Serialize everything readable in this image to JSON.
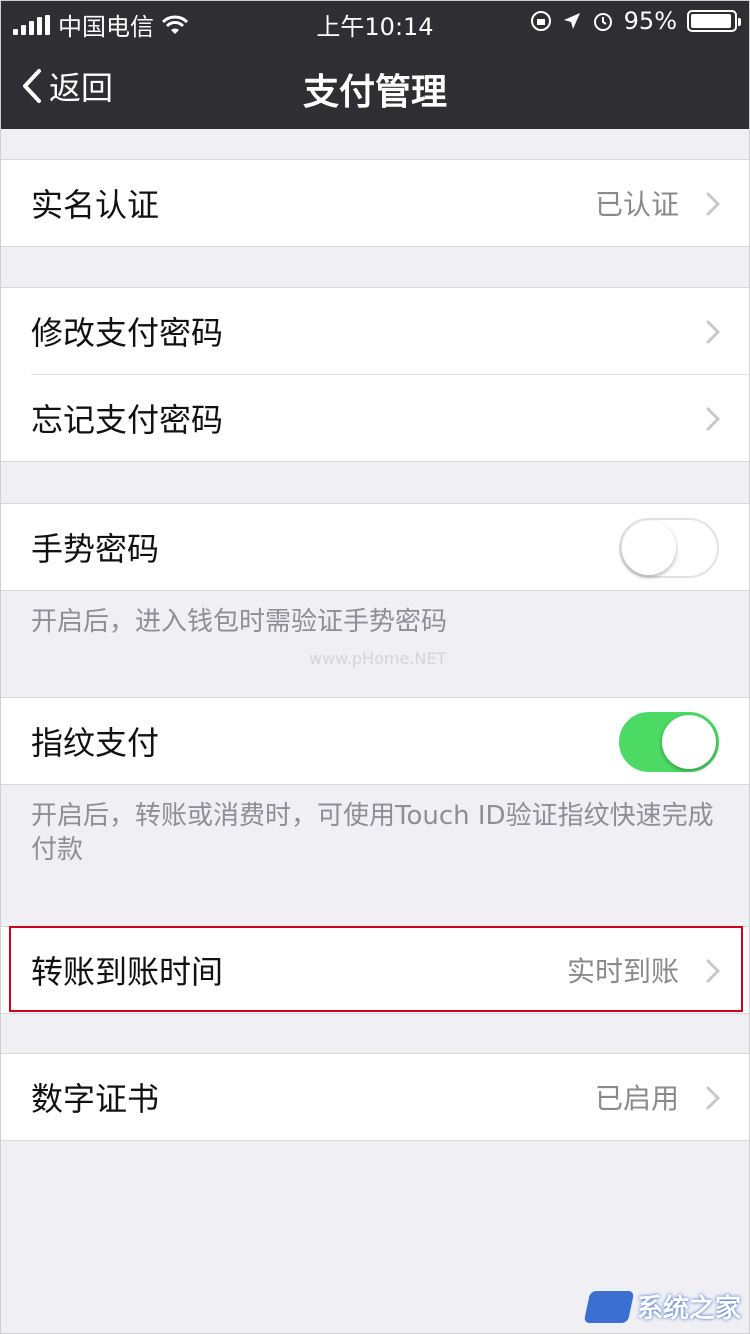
{
  "status_bar": {
    "carrier": "中国电信",
    "time": "上午10:14",
    "battery": "95%",
    "battery_level": 0.95
  },
  "nav": {
    "back_label": "返回",
    "title": "支付管理"
  },
  "groups": {
    "realname": {
      "label": "实名认证",
      "value": "已认证"
    },
    "change_pwd": {
      "label": "修改支付密码"
    },
    "forgot_pwd": {
      "label": "忘记支付密码"
    },
    "gesture": {
      "label": "手势密码",
      "enabled": false,
      "hint": "开启后，进入钱包时需验证手势密码"
    },
    "fingerprint": {
      "label": "指纹支付",
      "enabled": true,
      "hint": "开启后，转账或消费时，可使用Touch ID验证指纹快速完成付款"
    },
    "transfer_time": {
      "label": "转账到账时间",
      "value": "实时到账"
    },
    "certificate": {
      "label": "数字证书",
      "value": "已启用"
    }
  },
  "watermark": "www.pHome.NET",
  "brand": {
    "name": "系统之家",
    "color": "#3b6fd1"
  },
  "colors": {
    "nav_bg": "#2e2e33",
    "toggle_on": "#4cd964",
    "highlight": "#d0021b"
  }
}
